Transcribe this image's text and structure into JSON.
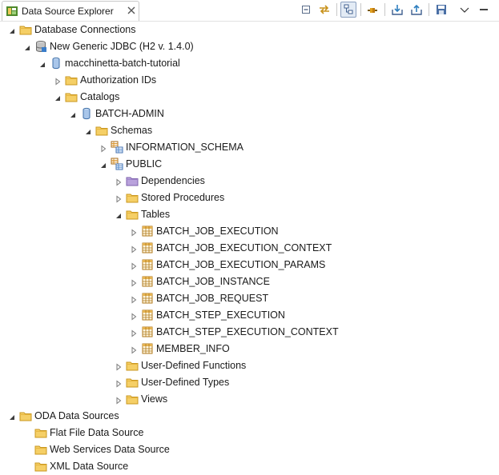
{
  "view": {
    "title": "Data Source Explorer",
    "toolbar": [
      "collapse-all-icon",
      "link-with-editor-icon",
      "filter-icon",
      "connect-icon",
      "import-icon",
      "export-icon",
      "save-icon",
      "view-menu-icon"
    ]
  },
  "tree": [
    {
      "label": "Database Connections",
      "depth": 0,
      "icon": "folder",
      "toggle": "expanded"
    },
    {
      "label": "New Generic JDBC (H2 v. 1.4.0)",
      "depth": 1,
      "icon": "database-connection",
      "toggle": "expanded"
    },
    {
      "label": "macchinetta-batch-tutorial",
      "depth": 2,
      "icon": "database",
      "toggle": "expanded"
    },
    {
      "label": "Authorization IDs",
      "depth": 3,
      "icon": "folder",
      "toggle": "collapsed"
    },
    {
      "label": "Catalogs",
      "depth": 3,
      "icon": "folder",
      "toggle": "expanded"
    },
    {
      "label": "BATCH-ADMIN",
      "depth": 4,
      "icon": "database",
      "toggle": "expanded"
    },
    {
      "label": "Schemas",
      "depth": 5,
      "icon": "folder",
      "toggle": "expanded"
    },
    {
      "label": "INFORMATION_SCHEMA",
      "depth": 6,
      "icon": "schema",
      "toggle": "collapsed"
    },
    {
      "label": "PUBLIC",
      "depth": 6,
      "icon": "schema",
      "toggle": "expanded"
    },
    {
      "label": "Dependencies",
      "depth": 7,
      "icon": "folder-purple",
      "toggle": "collapsed"
    },
    {
      "label": "Stored Procedures",
      "depth": 7,
      "icon": "folder",
      "toggle": "collapsed"
    },
    {
      "label": "Tables",
      "depth": 7,
      "icon": "folder",
      "toggle": "expanded"
    },
    {
      "label": "BATCH_JOB_EXECUTION",
      "depth": 8,
      "icon": "table",
      "toggle": "collapsed"
    },
    {
      "label": "BATCH_JOB_EXECUTION_CONTEXT",
      "depth": 8,
      "icon": "table",
      "toggle": "collapsed"
    },
    {
      "label": "BATCH_JOB_EXECUTION_PARAMS",
      "depth": 8,
      "icon": "table",
      "toggle": "collapsed"
    },
    {
      "label": "BATCH_JOB_INSTANCE",
      "depth": 8,
      "icon": "table",
      "toggle": "collapsed"
    },
    {
      "label": "BATCH_JOB_REQUEST",
      "depth": 8,
      "icon": "table",
      "toggle": "collapsed"
    },
    {
      "label": "BATCH_STEP_EXECUTION",
      "depth": 8,
      "icon": "table",
      "toggle": "collapsed"
    },
    {
      "label": "BATCH_STEP_EXECUTION_CONTEXT",
      "depth": 8,
      "icon": "table",
      "toggle": "collapsed"
    },
    {
      "label": "MEMBER_INFO",
      "depth": 8,
      "icon": "table",
      "toggle": "collapsed"
    },
    {
      "label": "User-Defined Functions",
      "depth": 7,
      "icon": "folder",
      "toggle": "collapsed"
    },
    {
      "label": "User-Defined Types",
      "depth": 7,
      "icon": "folder",
      "toggle": "collapsed"
    },
    {
      "label": "Views",
      "depth": 7,
      "icon": "folder",
      "toggle": "collapsed"
    },
    {
      "label": "ODA Data Sources",
      "depth": 0,
      "icon": "folder",
      "toggle": "expanded"
    },
    {
      "label": "Flat File Data Source",
      "depth": 1,
      "icon": "folder",
      "toggle": "none"
    },
    {
      "label": "Web Services Data Source",
      "depth": 1,
      "icon": "folder",
      "toggle": "none"
    },
    {
      "label": "XML Data Source",
      "depth": 1,
      "icon": "folder",
      "toggle": "none"
    }
  ]
}
